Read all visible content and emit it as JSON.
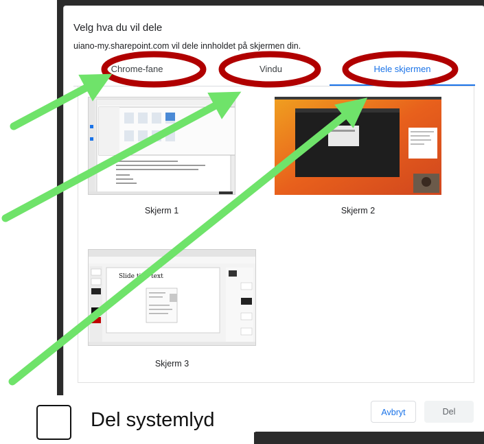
{
  "dialog": {
    "title": "Velg hva du vil dele",
    "subtitle": "uiano-my.sharepoint.com vil dele innholdet på skjermen din."
  },
  "tabs": [
    {
      "label": "Chrome-fane",
      "active": false
    },
    {
      "label": "Vindu",
      "active": false
    },
    {
      "label": "Hele skjermen",
      "active": true
    }
  ],
  "screens": [
    {
      "label": "Skjerm 1"
    },
    {
      "label": "Skjerm 2"
    },
    {
      "label": "Skjerm 3"
    }
  ],
  "thumbnail_texts": {
    "slide_title": "Slide title text"
  },
  "buttons": {
    "cancel": "Avbryt",
    "share": "Del"
  },
  "audio": {
    "label": "Del systemlyd",
    "checked": false
  },
  "colors": {
    "accent": "#1a73e8",
    "ellipse": "#b00000",
    "arrow": "#6fe36a"
  }
}
